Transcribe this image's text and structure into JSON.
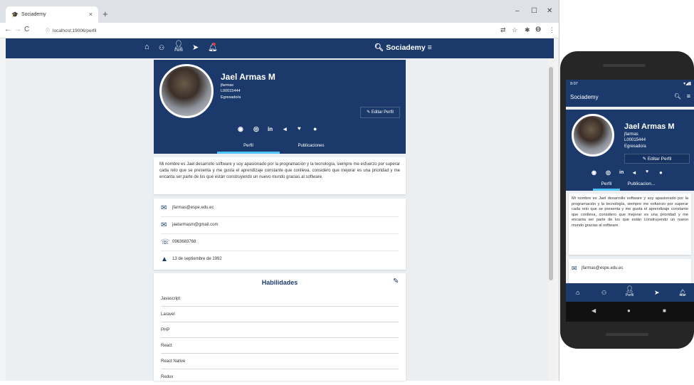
{
  "browser": {
    "tab_title": "Sociademy",
    "tab_close": "×",
    "new_tab": "+",
    "url": "localhost:19006/perfil",
    "controls": {
      "minimize": "–",
      "maximize": "☐",
      "close": "✕"
    }
  },
  "app": {
    "brand": "Sociademy",
    "nav_profile_label": "Perfil"
  },
  "profile": {
    "name": "Jael Armas M",
    "username": "jfarmas",
    "id": "L00015444",
    "status": "Egresado/a",
    "edit_button": "Editar Perfil",
    "tabs": [
      "Perfil",
      "Publicaciones"
    ],
    "phone_tabs": [
      "Perfil",
      "Publicacion..."
    ],
    "social": [
      "github-icon",
      "instagram-icon",
      "linkedin-icon",
      "telegram-icon",
      "twitter-icon",
      "web-icon"
    ]
  },
  "bio": "Mi nombre es Jael desarrollo software y soy apasionado por la programación y la tecnología, siempre me esfuerzo por superar cada reto que se presenta y me gusta el aprendizaje constante que conlleva, considero que mejorar es una prioridad y me encanta ser parte de los que están construyendo un nuevo mundo gracias al software.",
  "contact": {
    "email_1": "jfarmas@espe.edu.ec",
    "email_2": "jaelarmasm@gmail.com",
    "phone": "0963683768",
    "birthday": "13 de septiembre de 1992"
  },
  "skills": {
    "title": "Habilidades",
    "items": [
      "Javascript",
      "Laravel",
      "PHP",
      "React",
      "React Native",
      "Redux"
    ]
  },
  "phone": {
    "time": "9:07",
    "app_title": "Sociademy",
    "nav_profile_label": "Perfil"
  },
  "colors": {
    "primary": "#1b3a6b",
    "accent": "#4fc3f7"
  }
}
